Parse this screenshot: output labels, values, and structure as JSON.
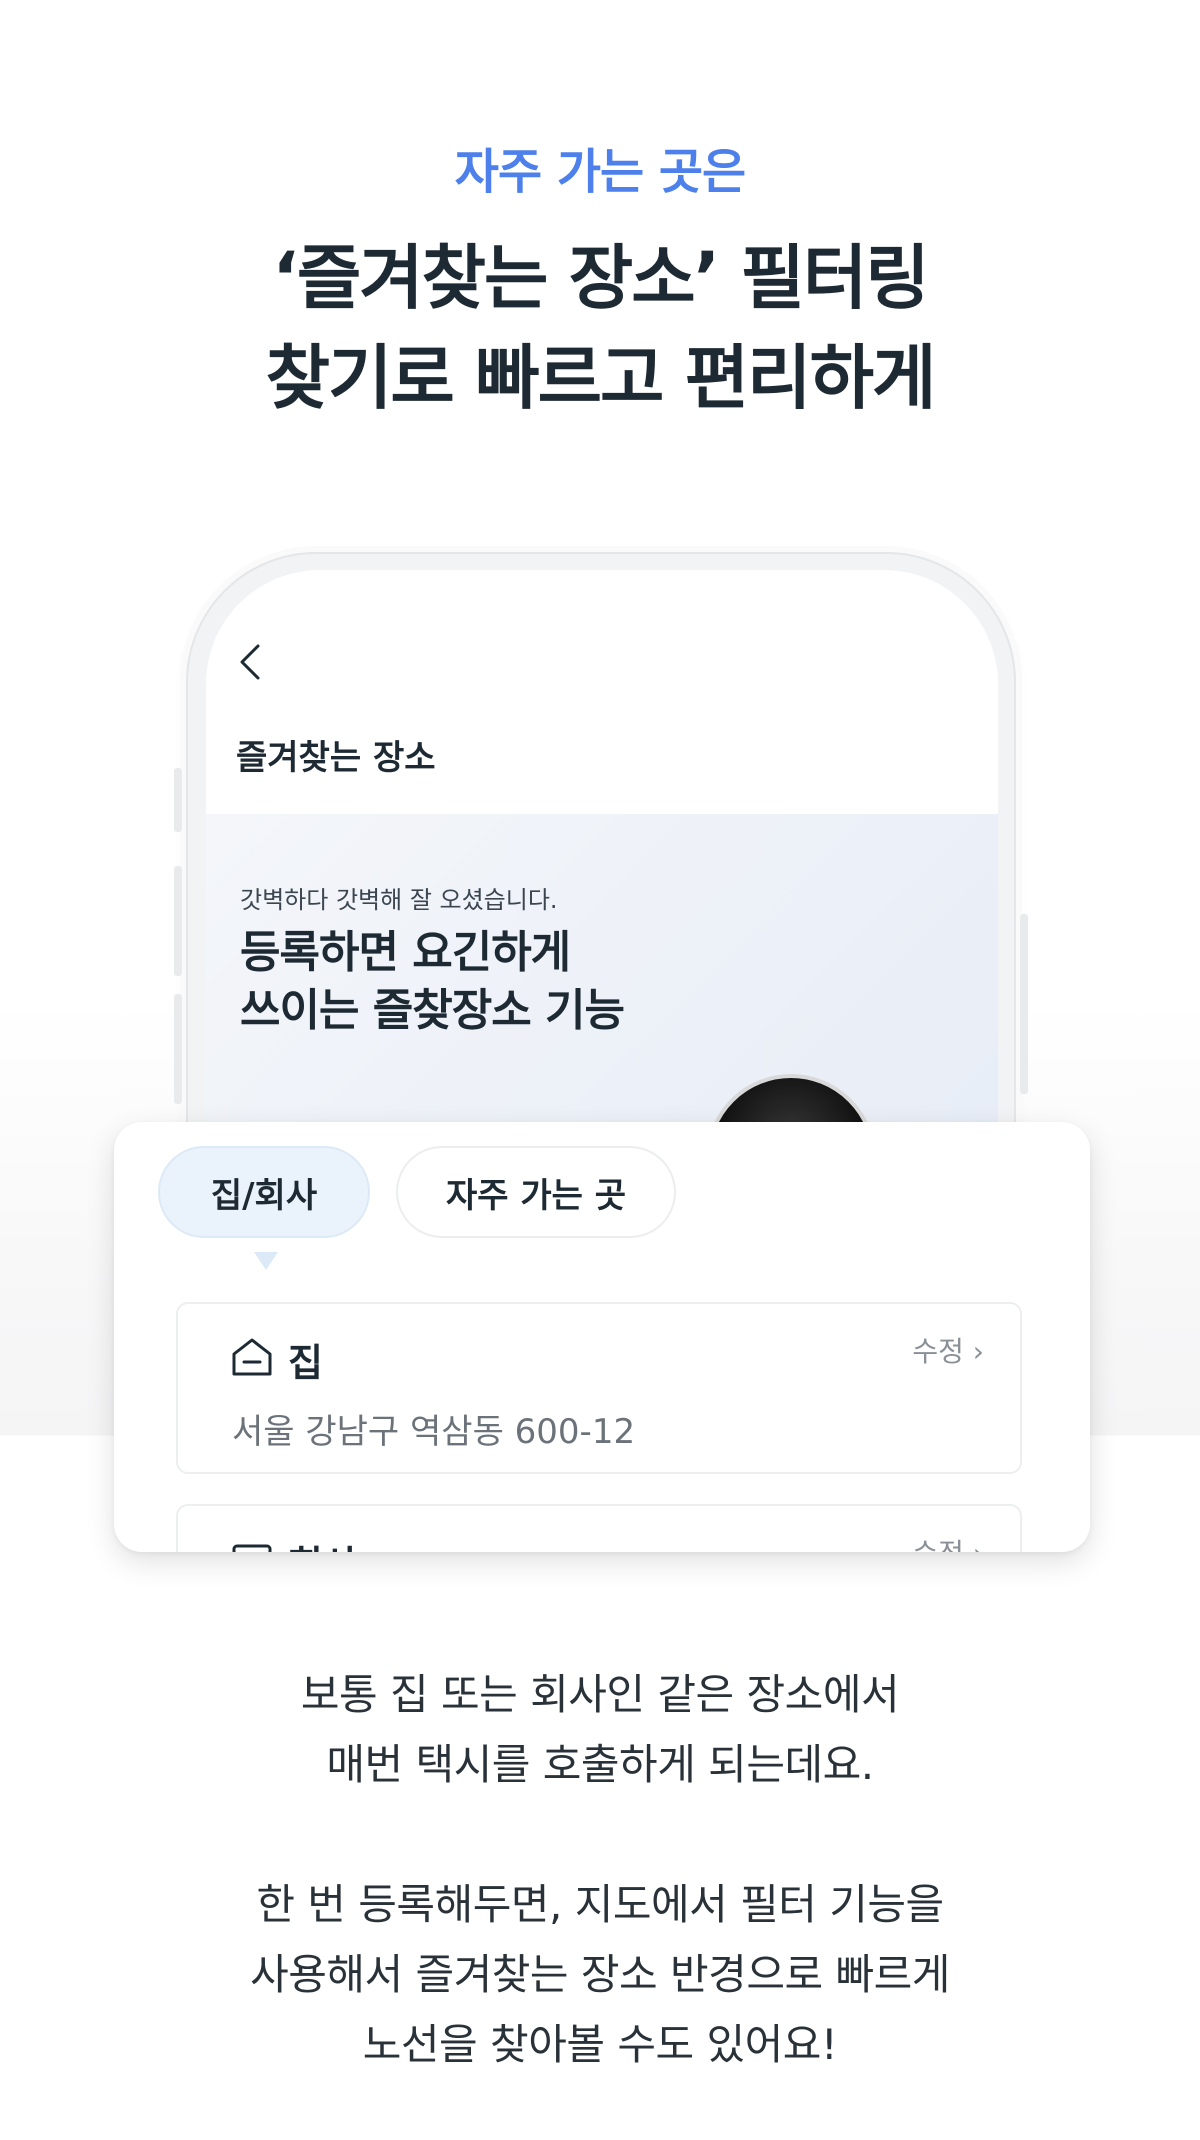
{
  "header": {
    "subtitle": "자주 가는 곳은",
    "headline_line1": "‘즐겨찾는 장소’ 필터링",
    "headline_line2": "찾기로 빠르고 편리하게"
  },
  "phone": {
    "screen_title": "즐겨찾는 장소",
    "banner": {
      "small_text": "갓벽하다 갓벽해 잘 오셨습니다.",
      "big_line1": "등록하면 요긴하게",
      "big_line2": "쓰이는 즐찾장소 기능"
    }
  },
  "card": {
    "tabs": [
      {
        "label": "집/회사",
        "selected": true
      },
      {
        "label": "자주 가는 곳",
        "selected": false
      }
    ],
    "places": [
      {
        "icon": "home-icon",
        "name": "집",
        "edit_label": "수정 ›",
        "address": "서울 강남구 역삼동 600-12"
      },
      {
        "icon": "office-icon",
        "name": "회사",
        "edit_label": "수정 ›",
        "address": ""
      }
    ]
  },
  "description": {
    "para1_line1": "보통 집 또는 회사인 같은 장소에서",
    "para1_line2": "매번 택시를 호출하게 되는데요.",
    "para2_line1": "한 번 등록해두면, 지도에서 필터 기능을",
    "para2_line2": "사용해서 즐겨찾는 장소 반경으로 빠르게",
    "para2_line3": "노선을 찾아볼 수도 있어요!"
  },
  "colors": {
    "accent": "#4d80ea",
    "text_dark": "#1e2a33",
    "tab_selected_bg": "#eaf3fc"
  }
}
